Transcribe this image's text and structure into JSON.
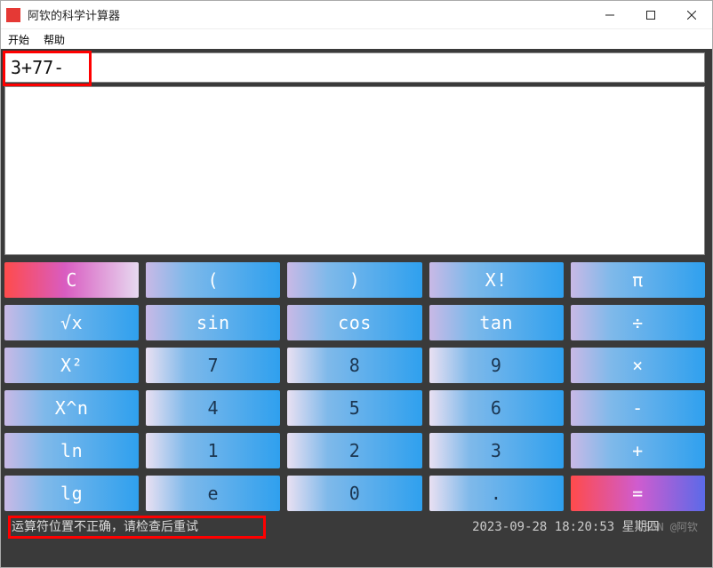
{
  "window": {
    "title": "阿钦的科学计算器"
  },
  "menu": {
    "start": "开始",
    "help": "帮助"
  },
  "input": {
    "value": "3+77-"
  },
  "keypad": {
    "r1": {
      "c": "C",
      "lp": "(",
      "rp": ")",
      "fact": "X!",
      "pi": "π"
    },
    "r2": {
      "sqrt": "√x",
      "sin": "sin",
      "cos": "cos",
      "tan": "tan",
      "div": "÷"
    },
    "r3": {
      "sq": "X²",
      "k7": "7",
      "k8": "8",
      "k9": "9",
      "mul": "×"
    },
    "r4": {
      "pow": "X^n",
      "k4": "4",
      "k5": "5",
      "k6": "6",
      "sub": "-"
    },
    "r5": {
      "ln": "ln",
      "k1": "1",
      "k2": "2",
      "k3": "3",
      "add": "+"
    },
    "r6": {
      "lg": "lg",
      "e": "e",
      "k0": "0",
      "dot": ".",
      "eq": "="
    }
  },
  "status": {
    "error": "运算符位置不正确，请检查后重试",
    "datetime": "2023-09-28 18:20:53 星期四"
  },
  "watermark": "CSDN @阿钦"
}
